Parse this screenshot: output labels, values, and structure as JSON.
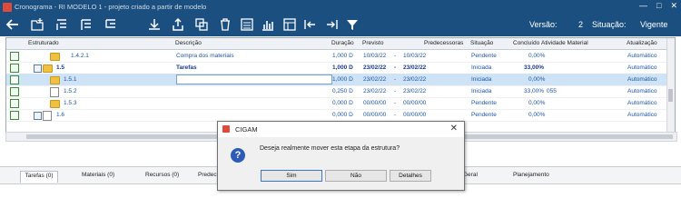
{
  "window": {
    "title": "Cronograma - RI MODELO 1 - projeto criado a partir de modelo"
  },
  "header": {
    "versao_label": "Versão:",
    "versao_value": "2",
    "situacao_label": "Situação:",
    "situacao_value": "Vigente"
  },
  "columns": [
    "Estruturado",
    "Descrição",
    "Duração",
    "Previsto",
    "Predecessoras",
    "Situação",
    "Concluído",
    "Atividade Material",
    "Atualização"
  ],
  "rows": [
    {
      "code": "1.4.2.1",
      "desc": "Compra dos materiais",
      "dur": "1,000 D",
      "start": "10/03/22",
      "sep": "-",
      "end": "10/03/22",
      "sit": "Pendente",
      "pct": "0,00%",
      "mat": "",
      "upd": "Automático"
    },
    {
      "code": "1.5",
      "desc": "Tarefas",
      "dur": "1,000 D",
      "start": "23/02/22",
      "sep": "-",
      "end": "23/02/22",
      "sit": "Iniciada",
      "pct": "33,00%",
      "mat": "",
      "upd": "Automático"
    },
    {
      "code": "1.5.1",
      "desc": "",
      "dur": "1,000 D",
      "start": "23/02/22",
      "sep": "-",
      "end": "23/02/22",
      "sit": "Iniciada",
      "pct": "0,00%",
      "mat": "",
      "upd": "Automático"
    },
    {
      "code": "1.5.2",
      "desc": "",
      "dur": "0,250 D",
      "start": "23/02/22",
      "sep": "-",
      "end": "23/02/22",
      "sit": "Iniciada",
      "pct": "33,00%",
      "mat": "055",
      "upd": "Automático"
    },
    {
      "code": "1.5.3",
      "desc": "",
      "dur": "0,000 D",
      "start": "00/00/00",
      "sep": "-",
      "end": "00/00/00",
      "sit": "Pendente",
      "pct": "0,00%",
      "mat": "",
      "upd": "Automático"
    },
    {
      "code": "1.6",
      "desc": "",
      "dur": "0,000 D",
      "start": "00/00/00",
      "sep": "-",
      "end": "00/00/00",
      "sit": "Pendente",
      "pct": "0,00%",
      "mat": "",
      "upd": "Automático"
    }
  ],
  "tabs": [
    "Tarefas (0)",
    "Materiais (0)",
    "Recursos (0)",
    "Predec",
    "Geral",
    "Planejamento"
  ],
  "dialog": {
    "title": "CIGAM",
    "message": "Deseja realmente mover esta etapa da estrutura?",
    "yes": "Sim",
    "no": "Não",
    "details": "Detalhes"
  },
  "icons": [
    "back-arrow-icon",
    "add-folder-icon",
    "insert-above-icon",
    "insert-below-icon",
    "insert-child-icon",
    "download-icon",
    "export-icon",
    "copy-icon",
    "delete-icon",
    "list-icon",
    "chart-icon",
    "properties-icon",
    "expand-icon",
    "collapse-left-icon",
    "indent-icon",
    "filter-icon"
  ]
}
